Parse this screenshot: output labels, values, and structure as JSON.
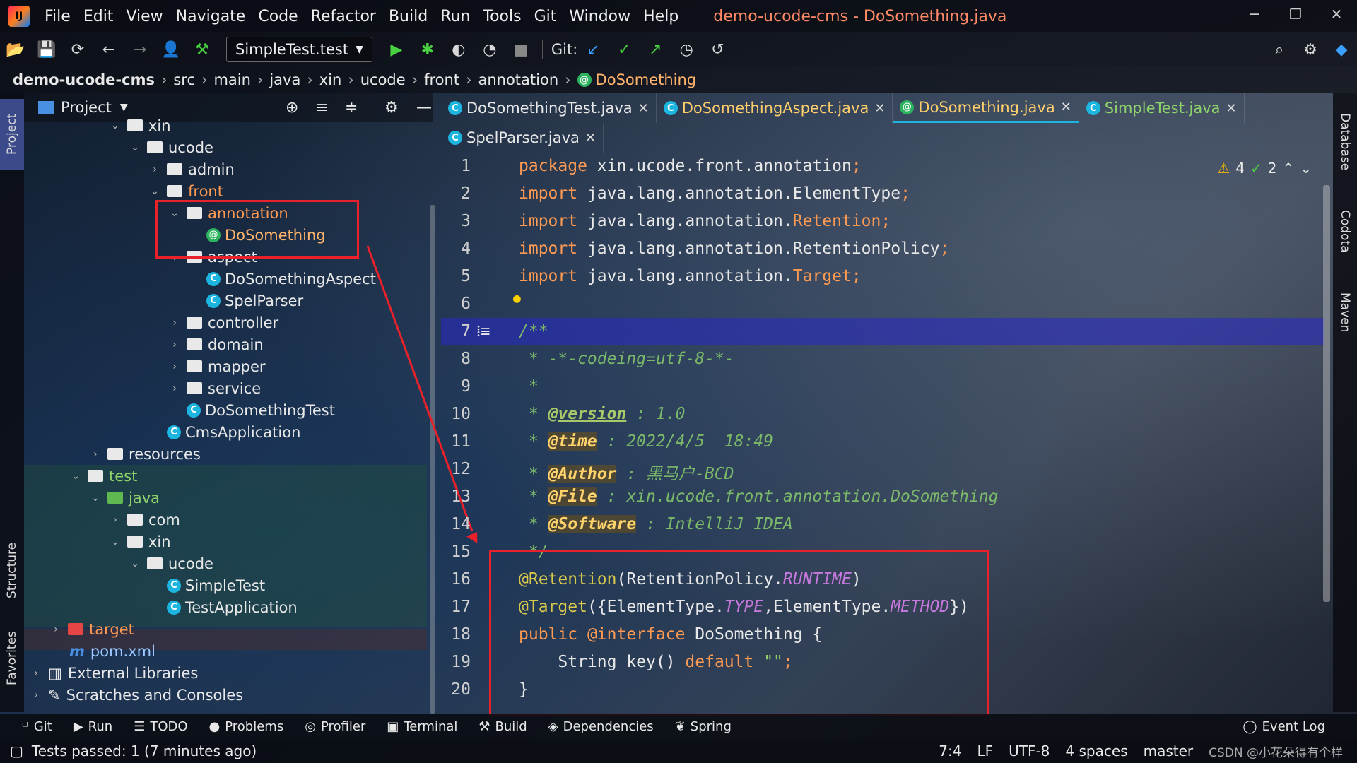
{
  "window": {
    "title": "demo-ucode-cms - DoSomething.java",
    "minimize": "─",
    "restore": "❐",
    "close": "✕"
  },
  "menu": [
    "File",
    "Edit",
    "View",
    "Navigate",
    "Code",
    "Refactor",
    "Build",
    "Run",
    "Tools",
    "Git",
    "Window",
    "Help"
  ],
  "toolbar": {
    "run_config": "SimpleTest.test",
    "git_label": "Git:"
  },
  "breadcrumb": [
    "demo-ucode-cms",
    "src",
    "main",
    "java",
    "xin",
    "ucode",
    "front",
    "annotation",
    "DoSomething"
  ],
  "project_panel": {
    "title": "Project"
  },
  "tree": [
    {
      "label": "xin",
      "icon": "folder"
    },
    {
      "label": "ucode",
      "icon": "folder"
    },
    {
      "label": "admin",
      "icon": "folder"
    },
    {
      "label": "front",
      "icon": "folder"
    },
    {
      "label": "annotation",
      "icon": "folder"
    },
    {
      "label": "DoSomething",
      "icon": "annotation-icon"
    },
    {
      "label": "aspect",
      "icon": "folder"
    },
    {
      "label": "DoSomethingAspect",
      "icon": "class-icon"
    },
    {
      "label": "SpelParser",
      "icon": "class-icon"
    },
    {
      "label": "controller",
      "icon": "folder"
    },
    {
      "label": "domain",
      "icon": "folder"
    },
    {
      "label": "mapper",
      "icon": "folder"
    },
    {
      "label": "service",
      "icon": "folder"
    },
    {
      "label": "DoSomethingTest",
      "icon": "class-icon"
    },
    {
      "label": "CmsApplication",
      "icon": "spring-class-icon"
    },
    {
      "label": "resources",
      "icon": "folder"
    },
    {
      "label": "test",
      "icon": "folder"
    },
    {
      "label": "java",
      "icon": "folder-green"
    },
    {
      "label": "com",
      "icon": "folder"
    },
    {
      "label": "xin",
      "icon": "folder"
    },
    {
      "label": "ucode",
      "icon": "folder"
    },
    {
      "label": "SimpleTest",
      "icon": "test-class-icon"
    },
    {
      "label": "TestApplication",
      "icon": "test-class-icon"
    },
    {
      "label": "target",
      "icon": "folder-red"
    },
    {
      "label": "pom.xml",
      "icon": "maven-icon"
    },
    {
      "label": "External Libraries",
      "icon": "library-icon"
    },
    {
      "label": "Scratches and Consoles",
      "icon": "scratch-icon"
    }
  ],
  "tabs_row1": [
    {
      "label": "DoSomethingTest.java",
      "icon": "class-icon"
    },
    {
      "label": "DoSomethingAspect.java",
      "icon": "class-icon"
    },
    {
      "label": "DoSomething.java",
      "icon": "annotation-icon"
    },
    {
      "label": "SimpleTest.java",
      "icon": "class-icon"
    }
  ],
  "tabs_row2": [
    {
      "label": "SpelParser.java",
      "icon": "class-icon"
    }
  ],
  "inspections": {
    "warnings": "4",
    "weak_warnings": "2"
  },
  "line_numbers": [
    "1",
    "2",
    "3",
    "4",
    "5",
    "6",
    "7",
    "8",
    "9",
    "10",
    "11",
    "12",
    "13",
    "14",
    "15",
    "16",
    "17",
    "18",
    "19",
    "20"
  ],
  "code": {
    "l1a": "package",
    "l1b": " xin.ucode.front.annotation",
    "l1c": ";",
    "l2a": "import",
    "l2b": " java.lang.annotation.ElementType",
    "l2c": ";",
    "l3a": "import",
    "l3b": " java.lang.annotation.",
    "l3c": "Retention",
    "l3d": ";",
    "l4a": "import",
    "l4b": " java.lang.annotation.RetentionPolicy",
    "l4c": ";",
    "l5a": "import",
    "l5b": " java.lang.annotation.",
    "l5c": "Target",
    "l5d": ";",
    "l7": "/**",
    "l8": " * -*-codeing=utf-8-*-",
    "l9": " *",
    "l10a": " * ",
    "l10b": "@version",
    "l10c": " : 1.0",
    "l11a": " * ",
    "l11b": "@time",
    "l11c": " : 2022/4/5  18:49",
    "l12a": " * ",
    "l12b": "@Author",
    "l12c": " : 黑马户-BCD",
    "l13a": " * ",
    "l13b": "@File",
    "l13c": " : xin.ucode.front.annotation.DoSomething",
    "l14a": " * ",
    "l14b": "@Software",
    "l14c": " : IntelliJ IDEA",
    "l15": " */",
    "l16a": "@Retention",
    "l16b": "(RetentionPolicy.",
    "l16c": "RUNTIME",
    "l16d": ")",
    "l17a": "@Target",
    "l17b": "({ElementType.",
    "l17c": "TYPE",
    "l17d": ",ElementType.",
    "l17e": "METHOD",
    "l17f": "})",
    "l18a": "public",
    "l18b": " @interface",
    "l18c": " DoSomething {",
    "l19a": "    String key() ",
    "l19b": "default",
    "l19c": " \"\"",
    "l19d": ";",
    "l20": "}"
  },
  "left_strip": [
    "Project",
    "Structure",
    "Favorites"
  ],
  "right_strip": [
    "Database",
    "Codota",
    "Maven"
  ],
  "bottom_tabs": [
    "Git",
    "Run",
    "TODO",
    "Problems",
    "Profiler",
    "Terminal",
    "Build",
    "Dependencies",
    "Spring"
  ],
  "event_log": "Event Log",
  "status": {
    "message": "Tests passed: 1 (7 minutes ago)",
    "position": "7:4",
    "line_sep": "LF",
    "encoding": "UTF-8",
    "indent": "4 spaces",
    "branch": "master",
    "watermark": "CSDN @小花朵得有个样"
  },
  "colors": {
    "accent": "#1cb5e0",
    "highlight_box": "#e8212a",
    "keyword": "#ff9a52"
  }
}
